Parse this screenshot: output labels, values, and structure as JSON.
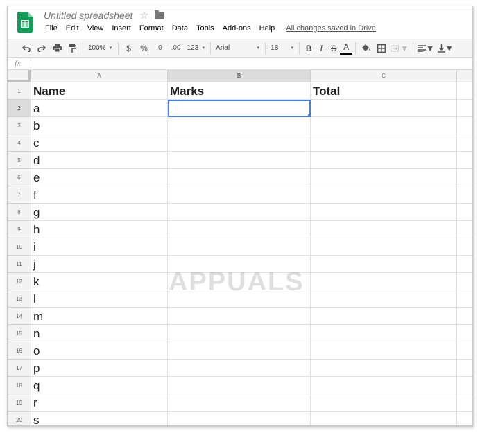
{
  "app": {
    "doc_title": "Untitled spreadsheet",
    "accent_color": "#0f9d58",
    "icons": [
      "sheets-logo-icon",
      "star-icon",
      "folder-icon"
    ]
  },
  "menu": {
    "items": [
      "File",
      "Edit",
      "View",
      "Insert",
      "Format",
      "Data",
      "Tools",
      "Add-ons",
      "Help"
    ],
    "saved_status": "All changes saved in Drive"
  },
  "toolbar": {
    "zoom": "100%",
    "currency": "$",
    "percent": "%",
    "decrease_decimal": ".0",
    "increase_decimal": ".00",
    "more_formats": "123",
    "font": "Arial",
    "font_size": "18",
    "bold": "B",
    "italic": "I",
    "strike": "S",
    "text_color": "A"
  },
  "formula_bar": {
    "label": "fx",
    "value": ""
  },
  "sheet": {
    "columns": [
      "A",
      "B",
      "C"
    ],
    "selected_column": "B",
    "active_cell": "B2",
    "rows": [
      {
        "num": "1",
        "cells": [
          "Name",
          "Marks",
          "Total"
        ]
      },
      {
        "num": "2",
        "cells": [
          "a",
          "",
          ""
        ]
      },
      {
        "num": "3",
        "cells": [
          "b",
          "",
          ""
        ]
      },
      {
        "num": "4",
        "cells": [
          "c",
          "",
          ""
        ]
      },
      {
        "num": "5",
        "cells": [
          "d",
          "",
          ""
        ]
      },
      {
        "num": "6",
        "cells": [
          "e",
          "",
          ""
        ]
      },
      {
        "num": "7",
        "cells": [
          "f",
          "",
          ""
        ]
      },
      {
        "num": "8",
        "cells": [
          "g",
          "",
          ""
        ]
      },
      {
        "num": "9",
        "cells": [
          "h",
          "",
          ""
        ]
      },
      {
        "num": "10",
        "cells": [
          "i",
          "",
          ""
        ]
      },
      {
        "num": "11",
        "cells": [
          "j",
          "",
          ""
        ]
      },
      {
        "num": "12",
        "cells": [
          "k",
          "",
          ""
        ]
      },
      {
        "num": "13",
        "cells": [
          "l",
          "",
          ""
        ]
      },
      {
        "num": "14",
        "cells": [
          "m",
          "",
          ""
        ]
      },
      {
        "num": "15",
        "cells": [
          "n",
          "",
          ""
        ]
      },
      {
        "num": "16",
        "cells": [
          "o",
          "",
          ""
        ]
      },
      {
        "num": "17",
        "cells": [
          "p",
          "",
          ""
        ]
      },
      {
        "num": "18",
        "cells": [
          "q",
          "",
          ""
        ]
      },
      {
        "num": "19",
        "cells": [
          "r",
          "",
          ""
        ]
      },
      {
        "num": "20",
        "cells": [
          "s",
          "",
          ""
        ]
      }
    ]
  },
  "watermark": "APPUALS"
}
